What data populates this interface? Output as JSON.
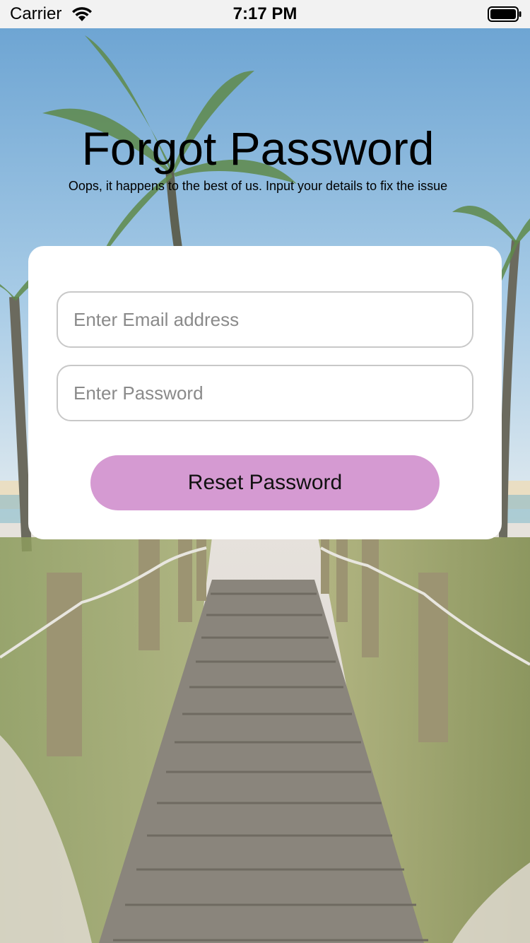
{
  "status_bar": {
    "carrier": "Carrier",
    "time": "7:17 PM",
    "icons": [
      "wifi-icon",
      "battery-icon"
    ]
  },
  "header": {
    "title": "Forgot Password",
    "subtitle": "Oops, it happens to the best of us. Input your details to fix the issue"
  },
  "form": {
    "email_placeholder": "Enter Email address",
    "email_value": "",
    "password_placeholder": "Enter Password",
    "password_value": "",
    "reset_label": "Reset Password"
  },
  "colors": {
    "button_bg": "#d59ad2",
    "card_bg": "#ffffff",
    "input_border": "#c8c8c8",
    "status_bar_bg": "#f2f2f2"
  }
}
